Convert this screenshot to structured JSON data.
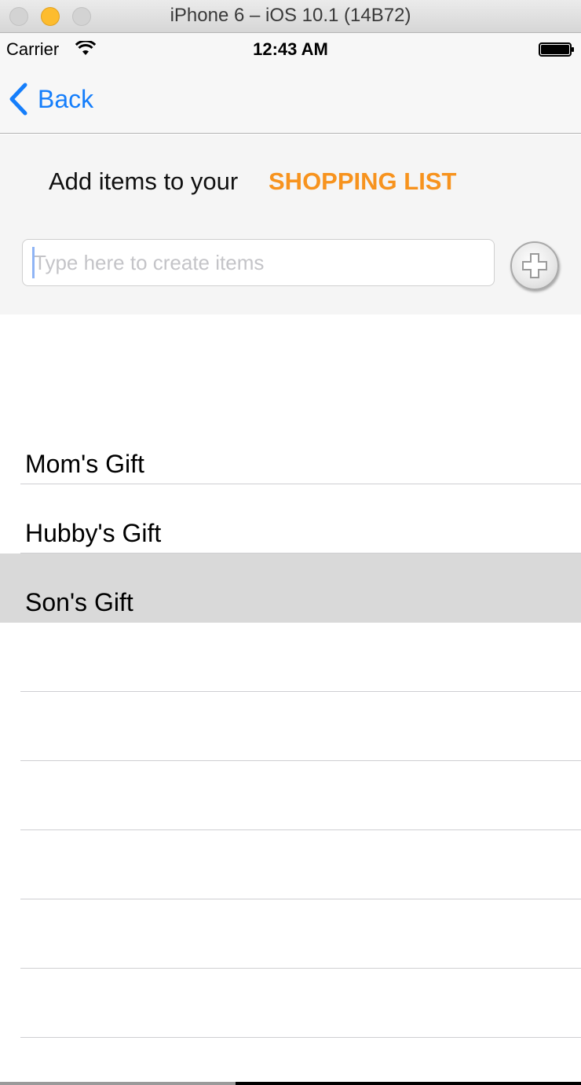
{
  "window": {
    "title": "iPhone 6 – iOS 10.1 (14B72)"
  },
  "status_bar": {
    "carrier": "Carrier",
    "time": "12:43 AM"
  },
  "nav": {
    "back_label": "Back"
  },
  "header": {
    "prompt": "Add items to your",
    "highlight": "SHOPPING LIST",
    "highlight_color": "#f7931e"
  },
  "input": {
    "value": "",
    "placeholder": "Type here to create items"
  },
  "list": {
    "items": [
      {
        "label": "Mom's Gift",
        "selected": false
      },
      {
        "label": "Hubby's Gift",
        "selected": false
      },
      {
        "label": "Son's Gift",
        "selected": true
      },
      {
        "label": "",
        "selected": false
      },
      {
        "label": "",
        "selected": false
      },
      {
        "label": "",
        "selected": false
      },
      {
        "label": "",
        "selected": false
      },
      {
        "label": "",
        "selected": false
      },
      {
        "label": "",
        "selected": false
      }
    ]
  },
  "colors": {
    "accent_blue": "#157efb",
    "selected_row": "#d9d9d9"
  }
}
